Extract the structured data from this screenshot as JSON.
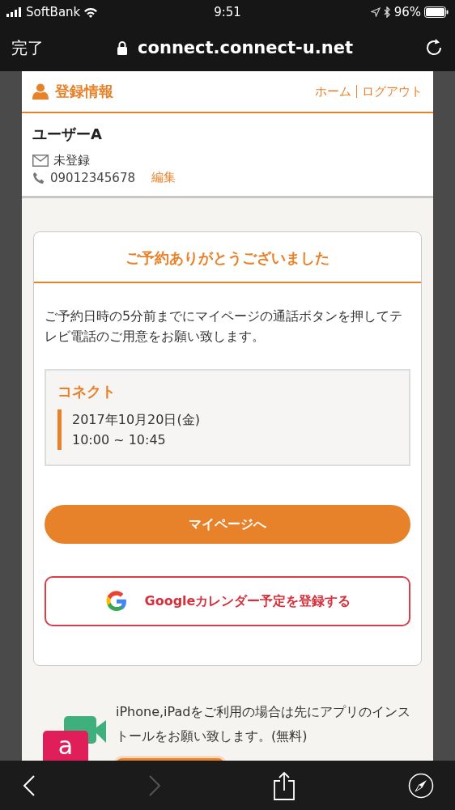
{
  "status_bar": {
    "carrier": "SoftBank",
    "time": "9:51",
    "battery": "96%"
  },
  "browser_bar": {
    "done": "完了",
    "url": "connect.connect-u.net"
  },
  "header": {
    "title": "登録情報",
    "links": [
      "ホーム",
      "ログアウト"
    ]
  },
  "user": {
    "name": "ユーザーA",
    "email": "未登録",
    "phone": "09012345678",
    "edit": "編集"
  },
  "card": {
    "title": "ご予約ありがとうございました",
    "message": "ご予約日時の5分前までにマイページの通話ボタンを押してテレビ電話のご用意をお願い致します。",
    "reservation": {
      "name": "コネクト",
      "date": "2017年10月20日(金)",
      "time": "10:00 ~ 10:45"
    },
    "mypage_button": "マイページへ",
    "calendar_button": "Googleカレンダー予定を登録する"
  },
  "app_promo": {
    "icon_letter": "a",
    "text": "iPhone,iPadをご利用の場合は先にアプリのインストールをお願い致します。(無料)"
  },
  "toolbar": {
    "back_disabled": false,
    "forward_disabled": true
  }
}
